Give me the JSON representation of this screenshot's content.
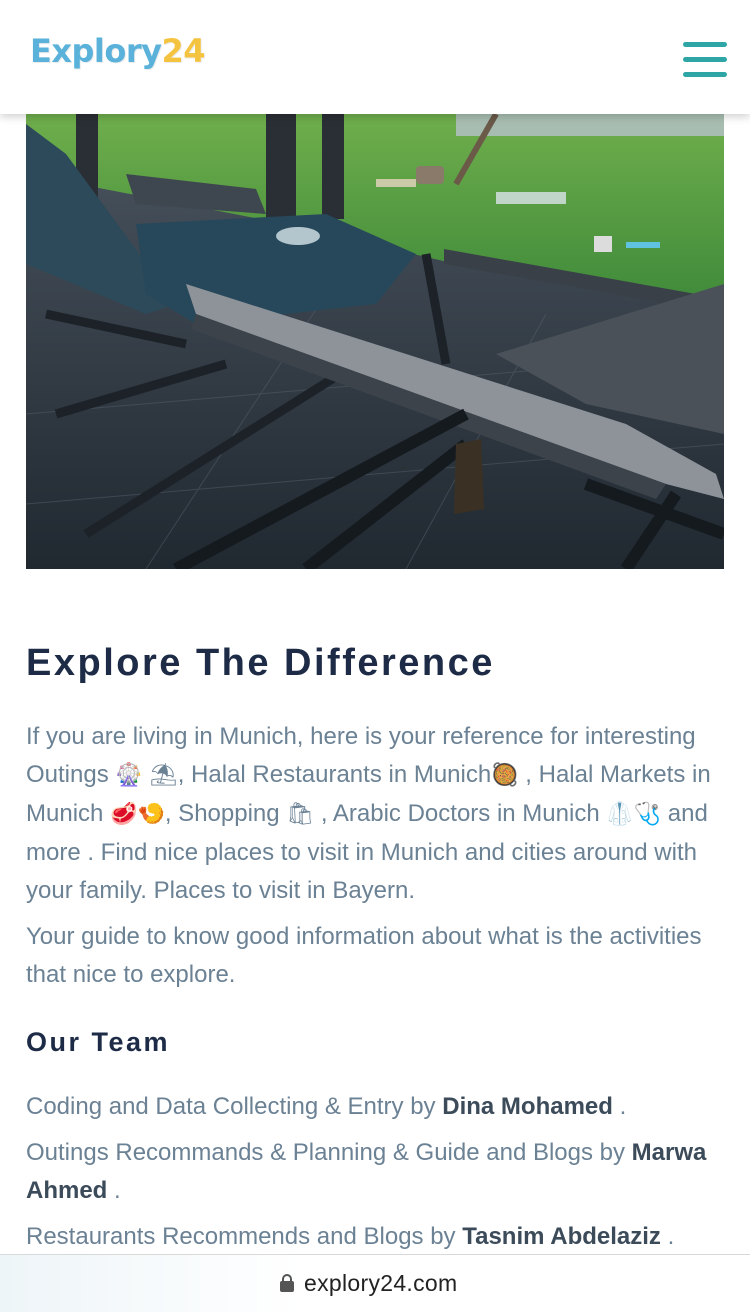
{
  "header": {
    "logo_text": "Explory",
    "logo_accent": "24",
    "menu_icon": "hamburger-menu-icon",
    "colors": {
      "logo_blue": "#5ab2db",
      "logo_yellow": "#f4c33f",
      "menu": "#2fa6a6"
    }
  },
  "hero": {
    "icon": "hero-photo"
  },
  "intro": {
    "title": "Explore The Difference",
    "p1_a": "If you are living in Munich, here is your reference for interesting Outings ",
    "p1_e1": "🎡 ⛱",
    "p1_b": ", Halal Restaurants in Munich",
    "p1_e2": "🥘",
    "p1_c": " , Halal Markets in Munich ",
    "p1_e3": "🥩🍤",
    "p1_d": ", Shopping ",
    "p1_e4": "🛍",
    "p1_f": " , Arabic Doctors in Munich ",
    "p1_e5": "🥼🩺",
    "p1_g": " and more . Find nice places to visit in Munich and cities around with your family. Places to visit in Bayern.",
    "p2": "Your guide to know good information about what is the activities that nice to explore."
  },
  "team": {
    "title": "Our Team",
    "r1_text": "Coding and Data Collecting & Entry by ",
    "r1_name": "Dina Mohamed",
    "r1_end": " .",
    "r2_text": "Outings Recommands & Planning & Guide and Blogs by ",
    "r2_name": "Marwa Ahmed",
    "r2_end": " .",
    "r3_text": "Restaurants Recommends and Blogs by ",
    "r3_name": "Tasnim Abdelaziz",
    "r3_end": " ."
  },
  "urlbar": {
    "url": "explory24.com",
    "icon": "lock-icon"
  }
}
